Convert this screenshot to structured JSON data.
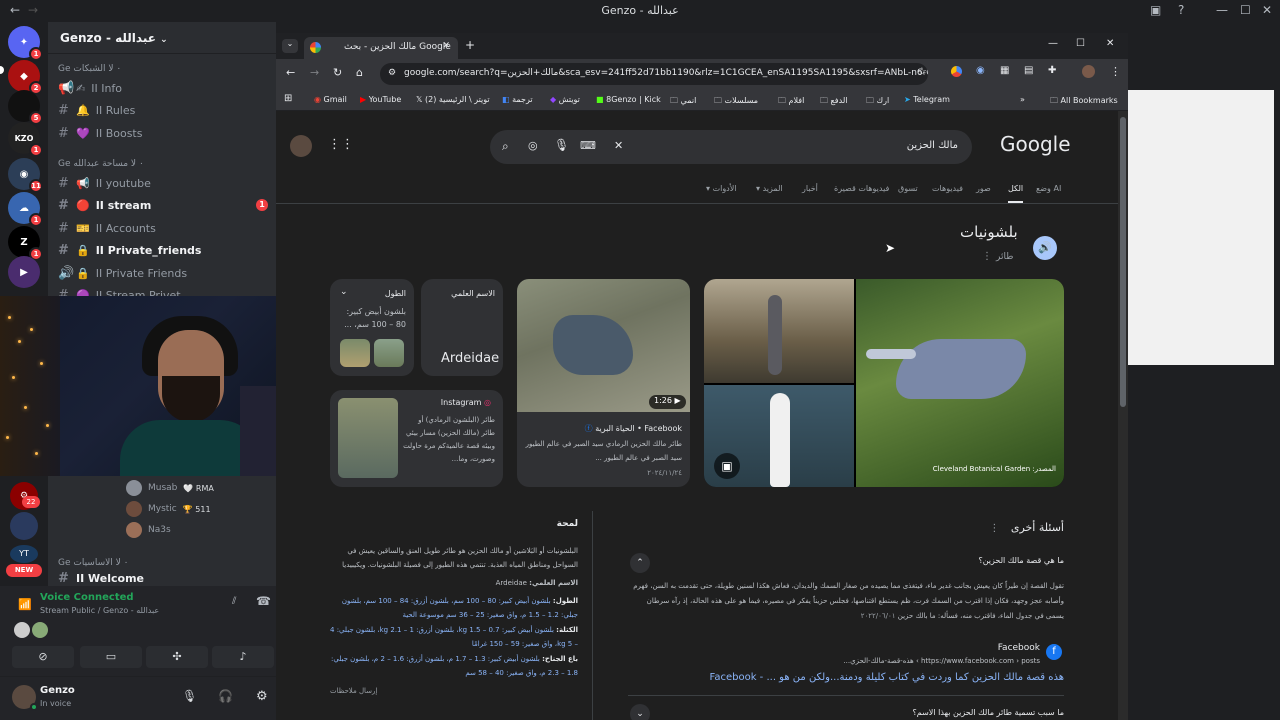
{
  "window": {
    "title": "Genzo - عبدالله"
  },
  "discord": {
    "server_name": "Genzo - عبدالله",
    "servers": [
      {
        "icon": "discord-home",
        "badge": "1"
      },
      {
        "icon": "server-red-logo",
        "badge": "2"
      },
      {
        "icon": "server-dark",
        "badge": "5"
      },
      {
        "icon": "server-kzo",
        "badge": "1"
      },
      {
        "icon": "server-blue",
        "badge": "11"
      },
      {
        "icon": "server-blurry",
        "badge": "1"
      },
      {
        "icon": "server-zlh",
        "badge": "1"
      },
      {
        "icon": "server-stream",
        "badge": ""
      }
    ],
    "categories": [
      "Ge ٠ لا الشبكات",
      "Ge ٠ لا مساحة عبدالله",
      "Ge ٠ لا الاساسيات"
    ],
    "channels_group1": [
      {
        "label": "II Info",
        "emoji": "✍"
      },
      {
        "label": "II Rules",
        "emoji": "🔔"
      },
      {
        "label": "II Boosts",
        "emoji": "💜"
      }
    ],
    "channels_group2": [
      {
        "label": "II youtube",
        "emoji": "📢"
      },
      {
        "label": "II stream",
        "emoji": "🔴",
        "badge": "1"
      },
      {
        "label": "II Accounts",
        "emoji": "🎫"
      },
      {
        "label": "II Private_friends",
        "emoji": "🔒"
      },
      {
        "label": "II Private Friends",
        "emoji": "🔒"
      },
      {
        "label": "II Stream Privet",
        "emoji": "🟣"
      }
    ],
    "channel_group3": "II Welcome",
    "voice_members": [
      {
        "name": "Musab",
        "tag": "🤍 RMA"
      },
      {
        "name": "Mystic",
        "tag": "🏆 511"
      },
      {
        "name": "Na3s",
        "tag": ""
      }
    ],
    "new_badge": "NEW",
    "new_badge_count": "22",
    "voice": {
      "status": "Voice Connected",
      "channel": "Stream Public / Genzo - عبدالله"
    },
    "user": {
      "name": "Genzo",
      "status": "In voice"
    }
  },
  "browser": {
    "tab_title": "مالك الحزين - بحث Google",
    "url": "google.com/search?q=مالك+الحزين&sca_esv=241ff52d71bb1190&rlz=1C1GCEA_enSA1195SA1195&sxsrf=ANbL-n6-GKo...",
    "bookmarks": [
      "Gmail",
      "YouTube",
      "تويتر \\ الرئيسية (2)",
      "ترجمة",
      "تويتش",
      "8Genzo | Kick",
      "انمي",
      "مسلسلات",
      "افلام",
      "الدفع",
      "ارك",
      "Telegram"
    ],
    "all_bookmarks": "All Bookmarks"
  },
  "google": {
    "logo": "Google",
    "query": "مالك الحزين",
    "nav_tabs": [
      "وضع AI",
      "الكل",
      "صور",
      "فيديوهات",
      "أخبار",
      "تسوق",
      "فيديوهات قصيرة",
      "المزيد",
      "الأدوات"
    ],
    "entity": {
      "title": "بلشونيات",
      "subtitle": "طائر"
    },
    "length_card": {
      "label": "الطول",
      "value": "بلشون أبيض كبير: 80 – 100 سم، ..."
    },
    "scientific_card": {
      "label": "الاسم العلمي",
      "value": "Ardeidae"
    },
    "instagram": {
      "source": "Instagram",
      "text": "طائر (البلشون الرمادي) أو طائر (مالك الحزين) مسار بيئي وبيئه قصة عالميةكم مرة حاولت وصورت، وما..."
    },
    "facebook_video": {
      "duration": "1:26",
      "source": "Facebook • الحياة البرية",
      "text": "طائر مالك الحزين الرمادي سيد الصبر في عالم الطيور سيد الصبر في عالم الطيور ...",
      "date": "٢٠٢٤/١١/٢٤"
    },
    "photo_caption": "المصدر: Cleveland Botanical Garden",
    "overview": {
      "heading": "لمحة",
      "text": "البلشونيات أو البَلاشين أو مالك الحزين هو طائر طويل العنق والساقين يعيش في السواحل ومناطق المياه العذبة. تنتمي هذه الطيور إلى فصيلة البلشونيات. ويكيبيديا",
      "sci_label": "الاسم العلمي:",
      "sci_value": "Ardeidae",
      "length_label": "الطول:",
      "length_value": "بلشون أبيض كبير: 80 – 100 سم، بلشون أزرق: 84 – 100 سم، بلشون جبلي: 1.2 – 1.5 م، واق صغير: 25 – 36 سم موسوعة الحية",
      "mass_label": "الكتلة:",
      "mass_value": "بلشون أبيض كبير: 0.7 – 1.5 kg، بلشون أزرق: 1 – 2.1 kg، بلشون جبلي: 4 – 5 kg، واق صغير: 59 – 150 غرامًا",
      "wing_label": "باع الجناح:",
      "wing_value": "بلشون أبيض كبير: 1.3 – 1.7 م، بلشون أزرق: 1.6 – 2 م، بلشون جبلي: 1.8 – 2.3 م، واق صغير: 40 – 58 سم",
      "feedback": "إرسال ملاحظات"
    },
    "people_also_ask": {
      "heading": "أسئلة أخرى",
      "q1": "ما هي قصة مالك الحزين؟",
      "a1": "تقول القصة إن طيراً كان يعيش بجانب غدير ماء، فيتغذى مما يصيده من صغار السمك والديدان، فعاش هكذا لسنين طويلة، حتى تقدمت به السن، فهرم وأصابه عجز وجهد، فكان إذا اقترب من السمك فرت، ظم يستطع اقتناصها، فجلس حزيناً يفكر في مصيره، فيما هو على هذه الحالة، إذ رآه سرطان يسمى في جدول الماء، فاقترب منه، فسأله: ما بالك حزين",
      "a1_date": "٢٠٢٢/٠٦/٠١",
      "source_name": "Facebook",
      "source_url": "https://www.facebook.com › posts › هذه-قصة-مالك-الحزي...",
      "link": "هذه قصة مالك الحزين كما وردت في كتاب كليلة ودمنة...ولكن من هو ... - Facebook",
      "q2": "ما سبب تسمية طائر مالك الحزين بهذا الاسم؟"
    }
  }
}
